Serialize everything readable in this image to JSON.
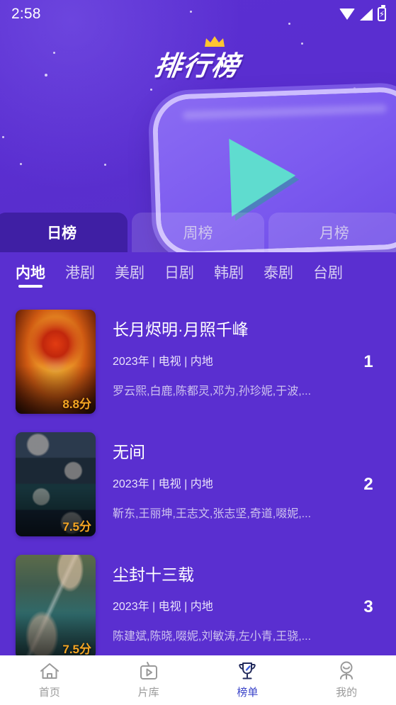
{
  "status_bar": {
    "time": "2:58",
    "icons": [
      "wifi-icon",
      "signal-icon",
      "battery-charging-icon"
    ]
  },
  "header": {
    "title": "排行榜",
    "crown_icon": "crown-icon",
    "play_icon": "play-triangle-icon",
    "background_color": "#5a2fd0",
    "accent_play_color": "#5fdccf"
  },
  "period_tabs": [
    {
      "label": "日榜",
      "active": true
    },
    {
      "label": "周榜",
      "active": false
    },
    {
      "label": "月榜",
      "active": false
    }
  ],
  "category_tabs": [
    {
      "label": "内地",
      "active": true
    },
    {
      "label": "港剧",
      "active": false
    },
    {
      "label": "美剧",
      "active": false
    },
    {
      "label": "日剧",
      "active": false
    },
    {
      "label": "韩剧",
      "active": false
    },
    {
      "label": "泰剧",
      "active": false
    },
    {
      "label": "台剧",
      "active": false
    }
  ],
  "list": [
    {
      "rank": "1",
      "title": "长月烬明·月照千峰",
      "meta": "2023年 | 电视 | 内地",
      "cast": "罗云熙,白鹿,陈都灵,邓为,孙珍妮,于波,...",
      "score": "8.8分"
    },
    {
      "rank": "2",
      "title": "无间",
      "meta": "2023年 | 电视 | 内地",
      "cast": "靳东,王丽坤,王志文,张志坚,奇道,啜妮,...",
      "score": "7.5分"
    },
    {
      "rank": "3",
      "title": "尘封十三载",
      "meta": "2023年 | 电视 | 内地",
      "cast": "陈建斌,陈晓,啜妮,刘敏涛,左小青,王骁,...",
      "score": "7.5分"
    }
  ],
  "bottom_nav": {
    "active_color": "#3b44c9",
    "inactive_color": "#9a9a9a",
    "items": [
      {
        "label": "首页",
        "icon": "home-icon",
        "active": false
      },
      {
        "label": "片库",
        "icon": "tv-play-icon",
        "active": false
      },
      {
        "label": "榜单",
        "icon": "trophy-icon",
        "active": true
      },
      {
        "label": "我的",
        "icon": "person-icon",
        "active": false
      }
    ]
  }
}
